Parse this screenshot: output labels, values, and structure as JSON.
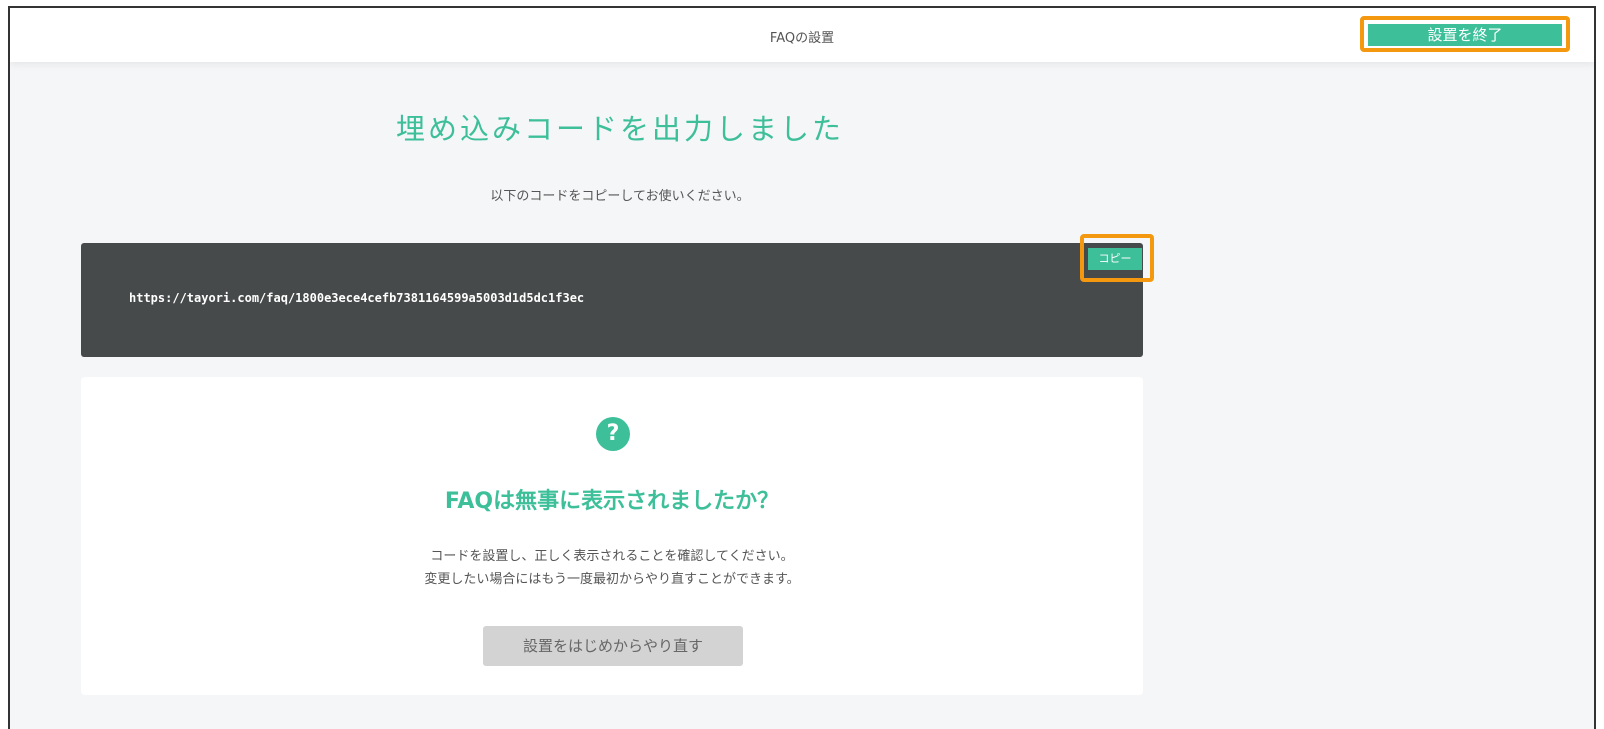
{
  "header": {
    "title": "FAQの設置",
    "finish_button": "設置を終了"
  },
  "main": {
    "heading": "埋め込みコードを出力しました",
    "subtext": "以下のコードをコピーしてお使いください。",
    "code": "https://tayori.com/faq/1800e3ece4cefb7381164599a5003d1d5dc1f3ec",
    "copy_button": "コピー"
  },
  "card": {
    "icon_glyph": "?",
    "icon_name": "question-icon",
    "title": "FAQは無事に表示されましたか？",
    "desc_line1": "コードを設置し、正しく表示されることを確認してください。",
    "desc_line2": "変更したい場合にはもう一度最初からやり直すことができます。",
    "restart_button": "設置をはじめからやり直す"
  },
  "colors": {
    "accent": "#3dbf99",
    "highlight": "#f3980f",
    "code_bg": "#474a4a"
  }
}
